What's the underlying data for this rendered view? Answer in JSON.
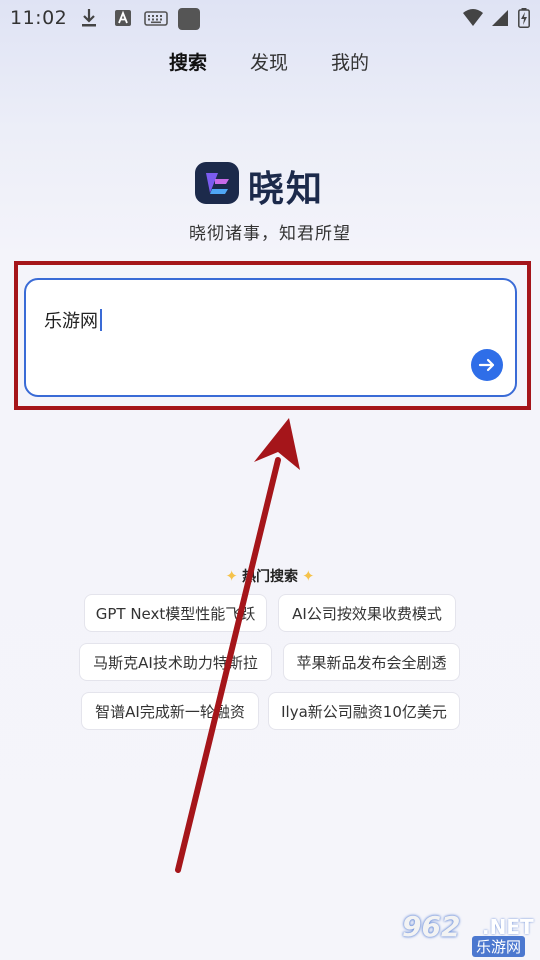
{
  "status_bar": {
    "time": "11:02"
  },
  "tabs": [
    {
      "label": "搜索"
    },
    {
      "label": "发现"
    },
    {
      "label": "我的"
    }
  ],
  "brand": {
    "name": "晓知",
    "tagline": "晓彻诸事，知君所望"
  },
  "search": {
    "value": "乐游网"
  },
  "hot": {
    "title": "热门搜索",
    "items": [
      "GPT Next模型性能飞跃",
      "AI公司按效果收费模式",
      "马斯克AI技术助力特斯拉",
      "苹果新品发布会全剧透",
      "智谱AI完成新一轮融资",
      "Ilya新公司融资10亿美元"
    ]
  },
  "watermark": {
    "number": "962",
    "domain": ".NET",
    "site": "乐游网"
  },
  "colors": {
    "accent": "#2f6ee8",
    "annotation": "#a5151a"
  }
}
